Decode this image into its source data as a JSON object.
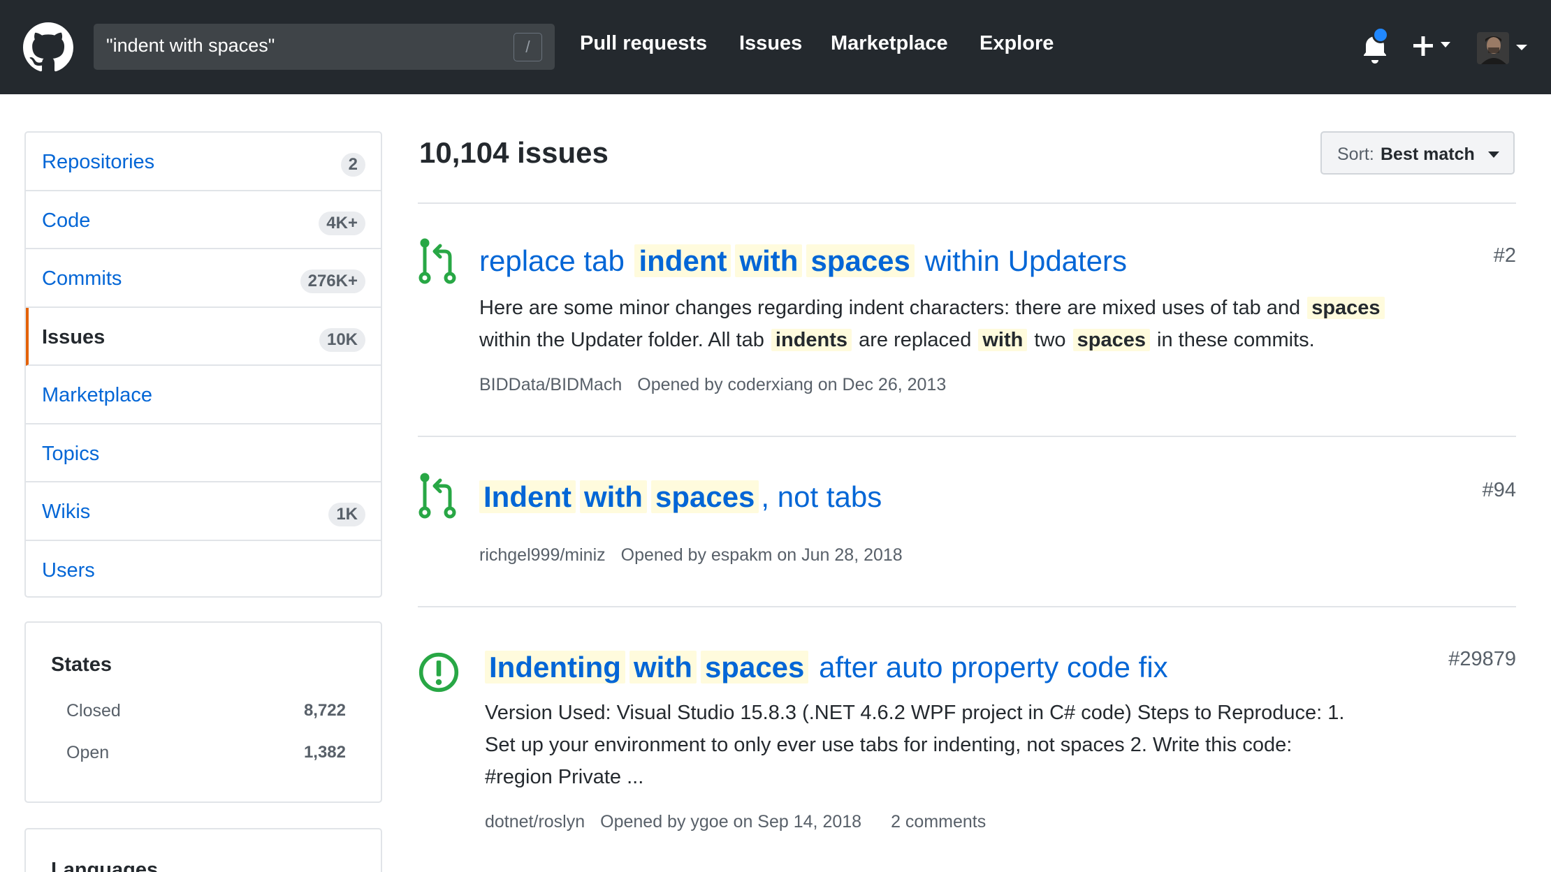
{
  "header": {
    "search_value": "\"indent with spaces\"",
    "search_shortcut": "/",
    "nav": [
      "Pull requests",
      "Issues",
      "Marketplace",
      "Explore"
    ],
    "icons": [
      "github-logo",
      "bell-icon",
      "plus-icon",
      "avatar"
    ]
  },
  "sidebar": {
    "items": [
      {
        "label": "Repositories",
        "count": "2"
      },
      {
        "label": "Code",
        "count": "4K+"
      },
      {
        "label": "Commits",
        "count": "276K+"
      },
      {
        "label": "Issues",
        "count": "10K",
        "selected": true
      },
      {
        "label": "Marketplace",
        "count": ""
      },
      {
        "label": "Topics",
        "count": ""
      },
      {
        "label": "Wikis",
        "count": "1K"
      },
      {
        "label": "Users",
        "count": ""
      }
    ],
    "states": {
      "title": "States",
      "rows": [
        {
          "label": "Closed",
          "count": "8,722"
        },
        {
          "label": "Open",
          "count": "1,382"
        }
      ]
    },
    "languages_title": "Languages"
  },
  "main": {
    "result_count": "10,104 issues",
    "sort": {
      "label": "Sort:",
      "value": "Best match"
    },
    "results": [
      {
        "type": "pull-request",
        "title": [
          "replace tab ",
          "indent",
          " ",
          "with",
          " ",
          "spaces",
          " within Updaters"
        ],
        "number": "#2",
        "body_line1": [
          "Here are some minor changes regarding indent characters: there are mixed uses of tab and ",
          "spaces"
        ],
        "body_line2": [
          "within the Updater folder. All tab ",
          "indents",
          " are replaced ",
          "with",
          " two ",
          "spaces",
          " in these commits."
        ],
        "repo": "BIDData/BIDMach",
        "opened": "Opened by coderxiang on Dec 26, 2013"
      },
      {
        "type": "pull-request",
        "title": [
          "Indent",
          " ",
          "with",
          " ",
          "spaces",
          ", not tabs"
        ],
        "number": "#94",
        "repo": "richgel999/miniz",
        "opened": "Opened by espakm on Jun 28, 2018"
      },
      {
        "type": "issue",
        "title": [
          "Indenting",
          " ",
          "with",
          " ",
          "spaces",
          " after auto property code fix"
        ],
        "number": "#29879",
        "body_line1": "Version Used: Visual Studio 15.8.3 (.NET 4.6.2 WPF project in C# code) Steps to Reproduce: 1.",
        "body_line2": "Set up your environment to only ever use tabs for indenting, not spaces 2. Write this code:",
        "body_line3": "#region Private ...",
        "repo": "dotnet/roslyn",
        "opened": "Opened by ygoe on Sep 14, 2018",
        "comments": "2 comments"
      }
    ]
  },
  "colors": {
    "header_bg": "#24292e",
    "link": "#0366d6",
    "highlight": "#fffbdd",
    "open_green": "#28a745",
    "selected_accent": "#e36209"
  }
}
